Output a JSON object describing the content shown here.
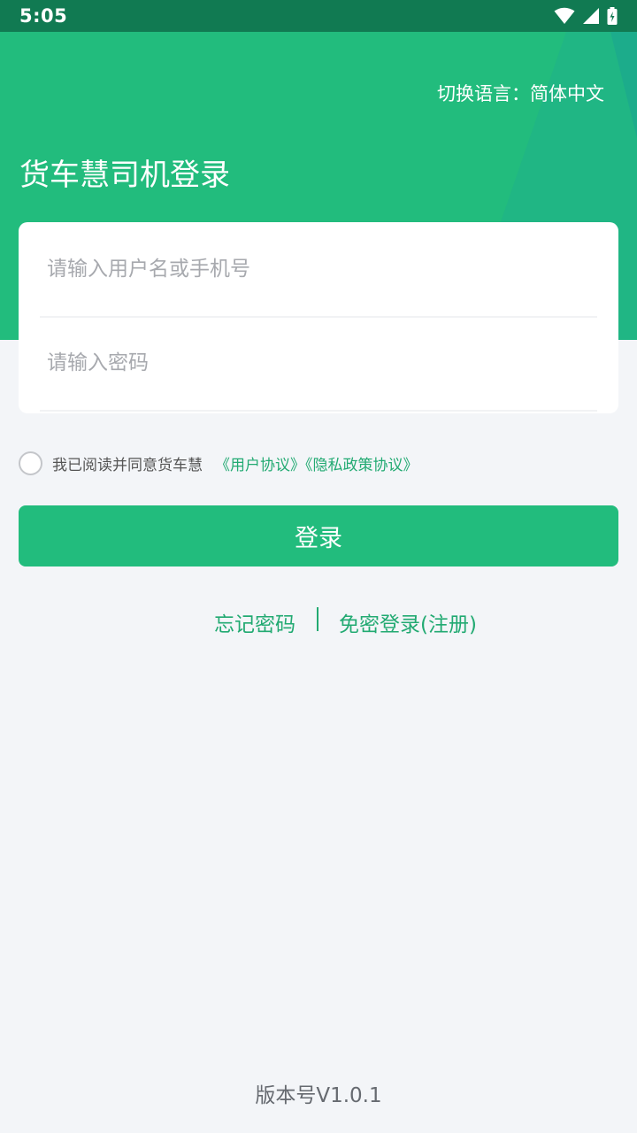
{
  "status_bar": {
    "time": "5:05",
    "icons": [
      "wifi-icon",
      "signal-icon",
      "battery-charging-icon"
    ]
  },
  "header": {
    "language_switch": "切换语言：简体中文",
    "title": "货车慧司机登录"
  },
  "form": {
    "username_placeholder": "请输入用户名或手机号",
    "username_value": "",
    "password_placeholder": "请输入密码",
    "password_value": ""
  },
  "agreement": {
    "checked": false,
    "text": "我已阅读并同意货车慧",
    "links": "《用户协议》《隐私政策协议》"
  },
  "login_button": "登录",
  "links": {
    "forgot_password": "忘记密码",
    "register": "免密登录(注册)"
  },
  "version": "版本号V1.0.1",
  "colors": {
    "brand_green": "#22bc7d",
    "status_bar": "#117a52",
    "link_green": "#22aa72",
    "background": "#f3f5f8"
  }
}
